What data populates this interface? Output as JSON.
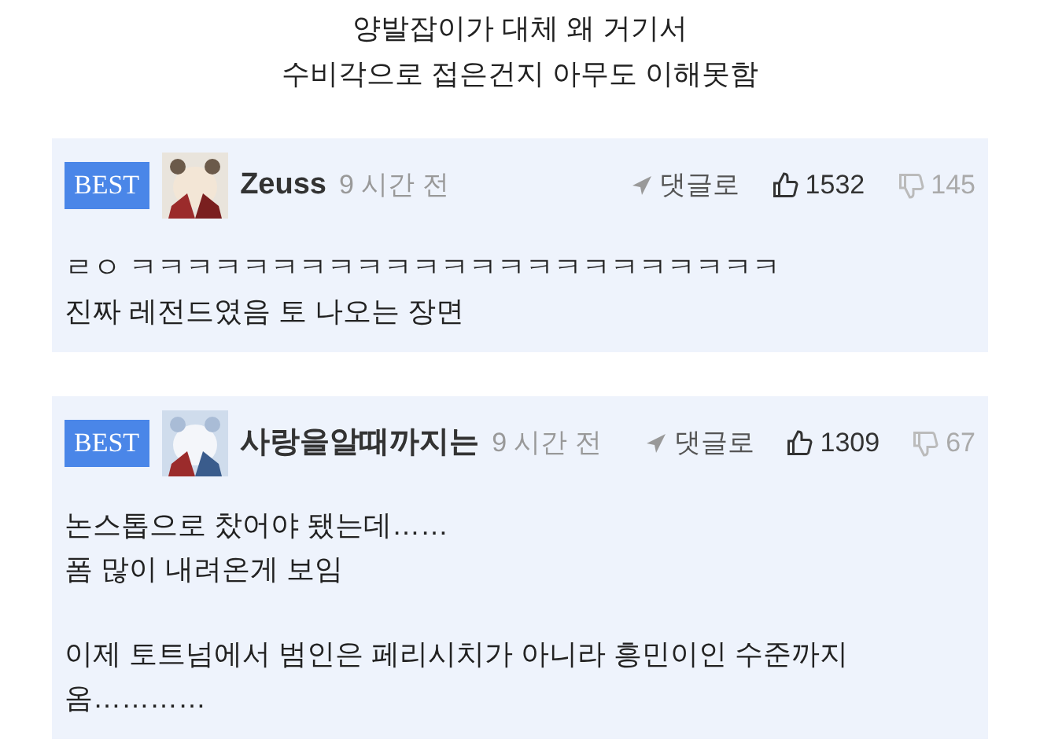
{
  "caption": [
    "양발잡이가 대체 왜 거기서",
    "수비각으로 접은건지 아무도 이해못함"
  ],
  "comments": [
    {
      "badge": "BEST",
      "avatar": {
        "kind": "picture"
      },
      "author": "Zeuss",
      "time": "9 시간 전",
      "reply": "댓글로",
      "likes": "1532",
      "dislikes": "145",
      "paragraphs": [
        [
          "ㄹㅇ ㅋㅋㅋㅋㅋㅋㅋㅋㅋㅋㅋㅋㅋㅋㅋㅋㅋㅋㅋㅋㅋㅋㅋ",
          "진짜 레전드였음 토 나오는 장면"
        ]
      ]
    },
    {
      "badge": "BEST",
      "avatar": {
        "kind": "picture"
      },
      "author": "사랑을알때까지는",
      "time": "9 시간 전",
      "reply": "댓글로",
      "likes": "1309",
      "dislikes": "67",
      "paragraphs": [
        [
          "논스톱으로 찼어야 됐는데……",
          "폼 많이 내려온게 보임"
        ],
        [
          "이제 토트넘에서 범인은 페리시치가 아니라 흥민이인 수준까지 옴…………"
        ]
      ]
    }
  ]
}
